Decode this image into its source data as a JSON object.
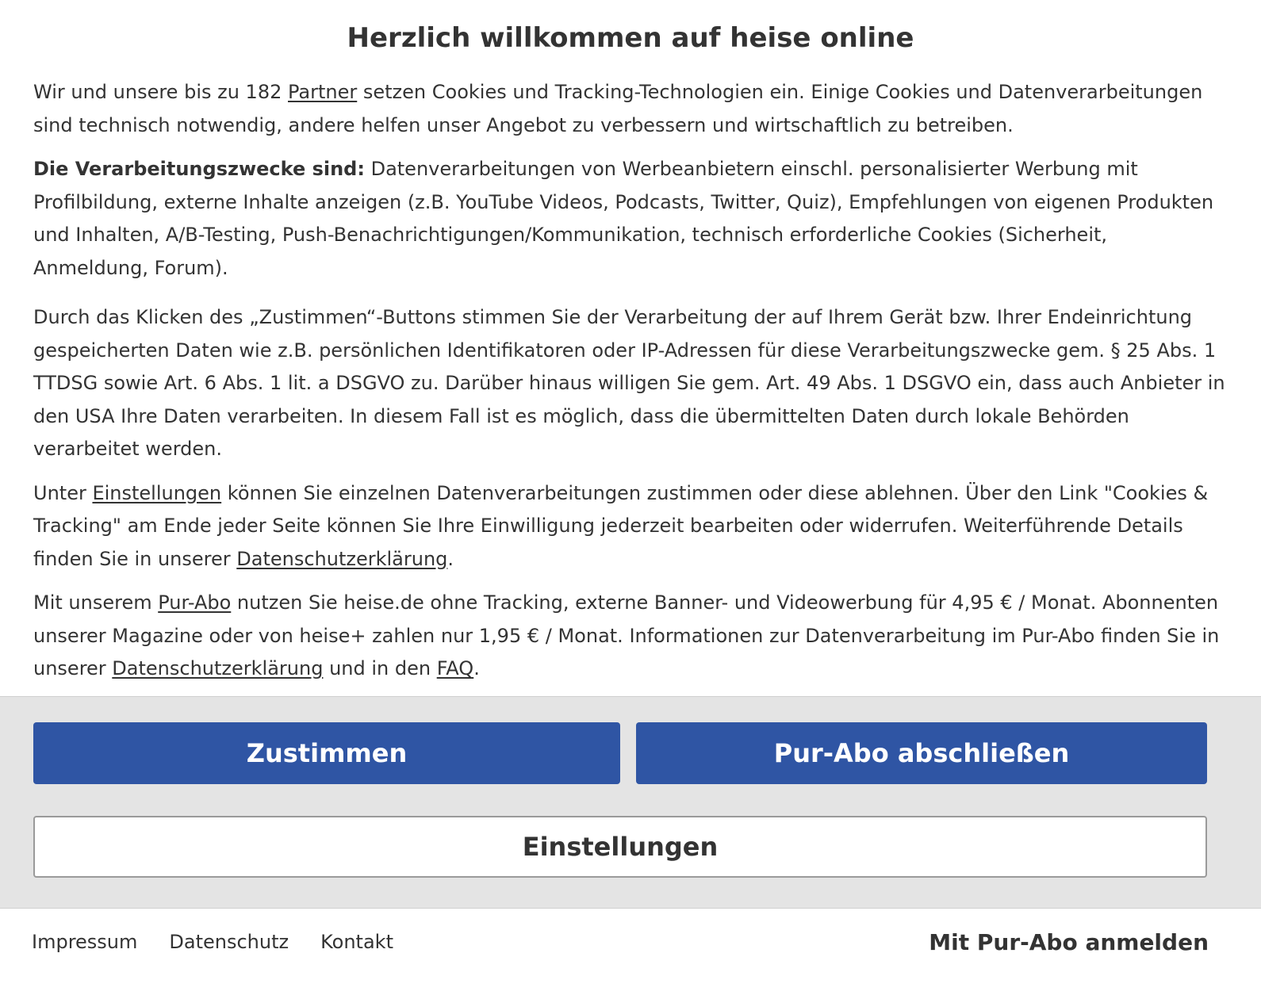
{
  "dialog": {
    "title": "Herzlich willkommen auf heise online"
  },
  "paragraph1": {
    "t1": "Wir und unsere bis zu 182 ",
    "link_partner": "Partner",
    "t2": " setzen Cookies und Tracking-Technologien ein. Einige Cookies und Datenverarbeitungen sind technisch notwendig, andere helfen unser Angebot zu verbessern und wirtschaftlich zu betreiben."
  },
  "paragraph2": {
    "bold": "Die Verarbeitungszwecke sind:",
    "text": " Datenverarbeitungen von Werbeanbietern einschl. personalisierter Werbung mit Profilbildung, externe Inhalte anzeigen (z.B. YouTube Videos, Podcasts, Twitter, Quiz), Empfehlungen von eigenen Produkten und Inhalten, A/B-Testing, Push-Benachrichtigungen/Kommunikation, technisch erforderliche Cookies (Sicherheit, Anmeldung, Forum)."
  },
  "paragraph3": {
    "text": "Durch das Klicken des „Zustimmen“-Buttons stimmen Sie der Verarbeitung der auf Ihrem Gerät bzw. Ihrer Endeinrichtung gespeicherten Daten wie z.B. persönlichen Identifikatoren oder IP-Adressen für diese Verarbeitungszwecke gem. § 25 Abs. 1 TTDSG sowie Art. 6 Abs. 1 lit. a DSGVO zu. Darüber hinaus willigen Sie gem. Art. 49 Abs. 1 DSGVO ein, dass auch Anbieter in den USA Ihre Daten verarbeiten. In diesem Fall ist es möglich, dass die übermittelten Daten durch lokale Behörden verarbeitet werden."
  },
  "paragraph4": {
    "t1": "Unter ",
    "link_settings": "Einstellungen",
    "t2": " können Sie einzelnen Datenverarbeitungen zustimmen oder diese ablehnen. Über den Link \"Cookies & Tracking\" am Ende jeder Seite können Sie Ihre Einwilligung jederzeit bearbeiten oder widerrufen. Weiterführende Details finden Sie in unserer ",
    "link_privacy": "Datenschutzerklärung",
    "t3": "."
  },
  "paragraph5": {
    "t1": "Mit unserem ",
    "link_pur": "Pur-Abo",
    "t2": " nutzen Sie heise.de ohne Tracking, externe Banner- und Videowerbung für 4,95 € / Monat. Abonnenten unserer Magazine oder von heise+ zahlen nur 1,95 € / Monat. Informationen zur Datenverarbeitung im Pur-Abo finden Sie in unserer ",
    "link_privacy": "Datenschutzerklärung",
    "t3": " und in den ",
    "link_faq": "FAQ",
    "t4": "."
  },
  "buttons": {
    "accept": "Zustimmen",
    "pur_abo": "Pur-Abo abschließen",
    "settings": "Einstellungen"
  },
  "footer": {
    "links": [
      "Impressum",
      "Datenschutz",
      "Kontakt"
    ],
    "login": "Mit Pur-Abo anmelden"
  },
  "colors": {
    "primary": "#2f55a4",
    "action_area_bg": "#e4e4e4",
    "text": "#333333"
  }
}
